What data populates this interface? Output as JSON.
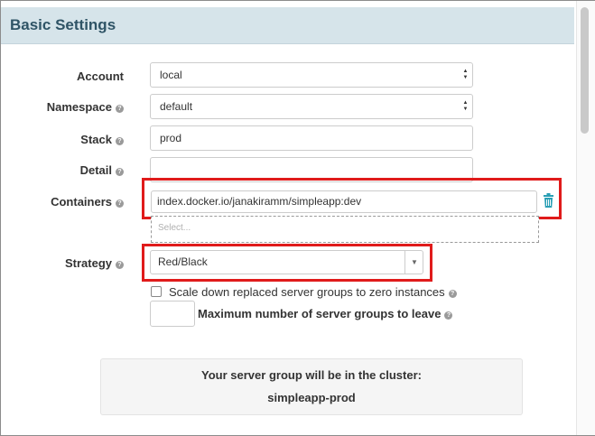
{
  "section": {
    "title": "Basic Settings"
  },
  "form": {
    "account": {
      "label": "Account",
      "value": "local"
    },
    "namespace": {
      "label": "Namespace",
      "value": "default"
    },
    "stack": {
      "label": "Stack",
      "value": "prod"
    },
    "detail": {
      "label": "Detail",
      "value": ""
    },
    "containers": {
      "label": "Containers",
      "value": "index.docker.io/janakiramm/simpleapp:dev",
      "select_placeholder": "Select..."
    },
    "strategy": {
      "label": "Strategy",
      "value": "Red/Black"
    },
    "scale_down": {
      "label": "Scale down replaced server groups to zero instances",
      "checked": false
    },
    "max_groups": {
      "label": "Maximum number of server groups to leave",
      "value": ""
    }
  },
  "cluster_info": {
    "line1": "Your server group will be in the cluster:",
    "cluster_name": "simpleapp-prod"
  },
  "icons": {
    "help": "help-circle-icon",
    "trash": "trash-icon",
    "select_arrows": "up-down-arrows-icon",
    "caret": "caret-down-icon"
  },
  "colors": {
    "header_bg": "#d6e4ea",
    "header_text": "#2f5466",
    "highlight": "#e01b1b",
    "trash": "#2a9fb5"
  }
}
